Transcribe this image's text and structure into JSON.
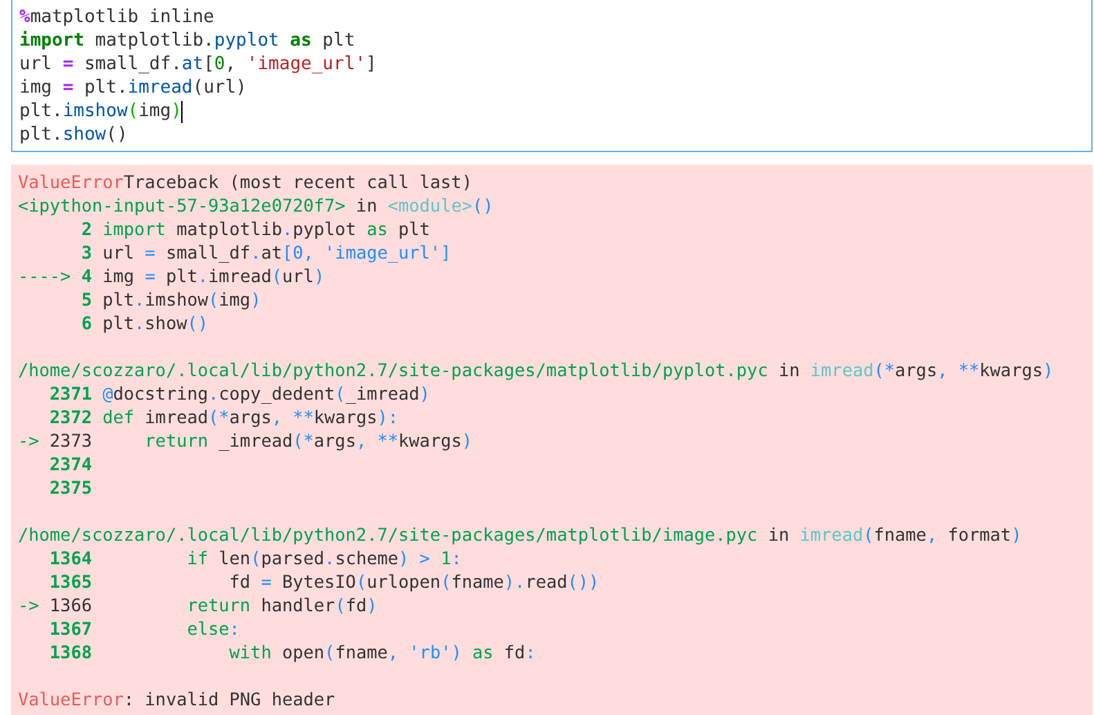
{
  "input_cell": {
    "lines": [
      {
        "cursor": false,
        "segments": [
          {
            "kind": "magic",
            "text": "%"
          },
          {
            "kind": "plain",
            "text": "matplotlib inline"
          }
        ]
      },
      {
        "cursor": false,
        "segments": [
          {
            "kind": "keyword",
            "text": "import"
          },
          {
            "kind": "plain",
            "text": " matplotlib."
          },
          {
            "kind": "attr",
            "text": "pyplot"
          },
          {
            "kind": "keyword",
            "text": " as"
          },
          {
            "kind": "plain",
            "text": " plt"
          }
        ]
      },
      {
        "cursor": false,
        "segments": [
          {
            "kind": "plain",
            "text": "url "
          },
          {
            "kind": "operator",
            "text": "="
          },
          {
            "kind": "plain",
            "text": " small_df."
          },
          {
            "kind": "attr",
            "text": "at"
          },
          {
            "kind": "plain",
            "text": "["
          },
          {
            "kind": "number",
            "text": "0"
          },
          {
            "kind": "plain",
            "text": ", "
          },
          {
            "kind": "string",
            "text": "'image_url'"
          },
          {
            "kind": "plain",
            "text": "]"
          }
        ]
      },
      {
        "cursor": false,
        "segments": [
          {
            "kind": "plain",
            "text": "img "
          },
          {
            "kind": "operator",
            "text": "="
          },
          {
            "kind": "plain",
            "text": " plt."
          },
          {
            "kind": "attr",
            "text": "imread"
          },
          {
            "kind": "plain",
            "text": "(url)"
          }
        ]
      },
      {
        "cursor": true,
        "segments": [
          {
            "kind": "plain",
            "text": "plt."
          },
          {
            "kind": "attr",
            "text": "imshow"
          },
          {
            "kind": "match",
            "text": "("
          },
          {
            "kind": "plain",
            "text": "img"
          },
          {
            "kind": "match",
            "text": ")"
          }
        ]
      },
      {
        "cursor": false,
        "segments": [
          {
            "kind": "plain",
            "text": "plt."
          },
          {
            "kind": "attr",
            "text": "show"
          },
          {
            "kind": "plain",
            "text": "()"
          }
        ]
      }
    ]
  },
  "output": {
    "blocks": [
      [
        {
          "segments": [
            {
              "kind": "error",
              "text": "ValueError"
            },
            {
              "kind": "plain",
              "text": "Traceback (most recent call last)"
            }
          ]
        },
        {
          "segments": [
            {
              "kind": "path",
              "text": "<ipython-input-57-93a12e0720f7>"
            },
            {
              "kind": "plain",
              "text": " in "
            },
            {
              "kind": "func",
              "text": "<module>"
            },
            {
              "kind": "punct",
              "text": "()"
            }
          ]
        },
        {
          "segments": [
            {
              "kind": "lineno",
              "text": "      2 "
            },
            {
              "kind": "keyword",
              "text": "import"
            },
            {
              "kind": "plain",
              "text": " matplotlib"
            },
            {
              "kind": "punct",
              "text": "."
            },
            {
              "kind": "plain",
              "text": "pyplot "
            },
            {
              "kind": "keyword",
              "text": "as"
            },
            {
              "kind": "plain",
              "text": " plt"
            }
          ]
        },
        {
          "segments": [
            {
              "kind": "lineno",
              "text": "      3 "
            },
            {
              "kind": "plain",
              "text": "url "
            },
            {
              "kind": "punct",
              "text": "="
            },
            {
              "kind": "plain",
              "text": " small_df"
            },
            {
              "kind": "punct",
              "text": "."
            },
            {
              "kind": "plain",
              "text": "at"
            },
            {
              "kind": "punct",
              "text": "[0, 'image_url']"
            }
          ]
        },
        {
          "segments": [
            {
              "kind": "path",
              "text": "----> "
            },
            {
              "kind": "lineno",
              "text": "4 "
            },
            {
              "kind": "plain",
              "text": "img "
            },
            {
              "kind": "punct",
              "text": "="
            },
            {
              "kind": "plain",
              "text": " plt"
            },
            {
              "kind": "punct",
              "text": "."
            },
            {
              "kind": "plain",
              "text": "imread"
            },
            {
              "kind": "punct",
              "text": "("
            },
            {
              "kind": "plain",
              "text": "url"
            },
            {
              "kind": "punct",
              "text": ")"
            }
          ]
        },
        {
          "segments": [
            {
              "kind": "lineno",
              "text": "      5 "
            },
            {
              "kind": "plain",
              "text": "plt"
            },
            {
              "kind": "punct",
              "text": "."
            },
            {
              "kind": "plain",
              "text": "imshow"
            },
            {
              "kind": "punct",
              "text": "("
            },
            {
              "kind": "plain",
              "text": "img"
            },
            {
              "kind": "punct",
              "text": ")"
            }
          ]
        },
        {
          "segments": [
            {
              "kind": "lineno",
              "text": "      6 "
            },
            {
              "kind": "plain",
              "text": "plt"
            },
            {
              "kind": "punct",
              "text": "."
            },
            {
              "kind": "plain",
              "text": "show"
            },
            {
              "kind": "punct",
              "text": "()"
            }
          ]
        }
      ],
      [
        {
          "segments": [
            {
              "kind": "path",
              "text": "/home/scozzaro/.local/lib/python2.7/site-packages/matplotlib/pyplot.pyc"
            },
            {
              "kind": "plain",
              "text": " in "
            },
            {
              "kind": "func",
              "text": "imread"
            },
            {
              "kind": "punct",
              "text": "(*"
            },
            {
              "kind": "plain",
              "text": "args"
            },
            {
              "kind": "punct",
              "text": ", **"
            },
            {
              "kind": "plain",
              "text": "kwargs"
            },
            {
              "kind": "punct",
              "text": ")"
            }
          ]
        },
        {
          "segments": [
            {
              "kind": "lineno",
              "text": "   2371 "
            },
            {
              "kind": "punct",
              "text": "@"
            },
            {
              "kind": "plain",
              "text": "docstring"
            },
            {
              "kind": "punct",
              "text": "."
            },
            {
              "kind": "plain",
              "text": "copy_dedent"
            },
            {
              "kind": "punct",
              "text": "("
            },
            {
              "kind": "plain",
              "text": "_imread"
            },
            {
              "kind": "punct",
              "text": ")"
            }
          ]
        },
        {
          "segments": [
            {
              "kind": "lineno",
              "text": "   2372 "
            },
            {
              "kind": "keyword",
              "text": "def"
            },
            {
              "kind": "plain",
              "text": " imread"
            },
            {
              "kind": "punct",
              "text": "(*"
            },
            {
              "kind": "plain",
              "text": "args"
            },
            {
              "kind": "punct",
              "text": ", **"
            },
            {
              "kind": "plain",
              "text": "kwargs"
            },
            {
              "kind": "punct",
              "text": "):"
            }
          ]
        },
        {
          "segments": [
            {
              "kind": "path",
              "text": "-> "
            },
            {
              "kind": "plain",
              "text": "2373     "
            },
            {
              "kind": "keyword",
              "text": "return"
            },
            {
              "kind": "plain",
              "text": " _imread"
            },
            {
              "kind": "punct",
              "text": "(*"
            },
            {
              "kind": "plain",
              "text": "args"
            },
            {
              "kind": "punct",
              "text": ", **"
            },
            {
              "kind": "plain",
              "text": "kwargs"
            },
            {
              "kind": "punct",
              "text": ")"
            }
          ]
        },
        {
          "segments": [
            {
              "kind": "lineno",
              "text": "   2374"
            }
          ]
        },
        {
          "segments": [
            {
              "kind": "lineno",
              "text": "   2375"
            }
          ]
        }
      ],
      [
        {
          "segments": [
            {
              "kind": "path",
              "text": "/home/scozzaro/.local/lib/python2.7/site-packages/matplotlib/image.pyc"
            },
            {
              "kind": "plain",
              "text": " in "
            },
            {
              "kind": "func",
              "text": "imread"
            },
            {
              "kind": "punct",
              "text": "("
            },
            {
              "kind": "plain",
              "text": "fname"
            },
            {
              "kind": "punct",
              "text": ", "
            },
            {
              "kind": "plain",
              "text": "format"
            },
            {
              "kind": "punct",
              "text": ")"
            }
          ]
        },
        {
          "segments": [
            {
              "kind": "lineno",
              "text": "   1364         "
            },
            {
              "kind": "keyword",
              "text": "if"
            },
            {
              "kind": "plain",
              "text": " len"
            },
            {
              "kind": "punct",
              "text": "("
            },
            {
              "kind": "plain",
              "text": "parsed"
            },
            {
              "kind": "punct",
              "text": "."
            },
            {
              "kind": "plain",
              "text": "scheme"
            },
            {
              "kind": "punct",
              "text": ") > "
            },
            {
              "kind": "keyword",
              "text": "1"
            },
            {
              "kind": "punct",
              "text": ":"
            }
          ]
        },
        {
          "segments": [
            {
              "kind": "lineno",
              "text": "   1365 "
            },
            {
              "kind": "plain",
              "text": "            fd "
            },
            {
              "kind": "punct",
              "text": "="
            },
            {
              "kind": "plain",
              "text": " BytesIO"
            },
            {
              "kind": "punct",
              "text": "("
            },
            {
              "kind": "plain",
              "text": "urlopen"
            },
            {
              "kind": "punct",
              "text": "("
            },
            {
              "kind": "plain",
              "text": "fname"
            },
            {
              "kind": "punct",
              "text": ")."
            },
            {
              "kind": "plain",
              "text": "read"
            },
            {
              "kind": "punct",
              "text": "())"
            }
          ]
        },
        {
          "segments": [
            {
              "kind": "path",
              "text": "-> "
            },
            {
              "kind": "plain",
              "text": "1366         "
            },
            {
              "kind": "keyword",
              "text": "return"
            },
            {
              "kind": "plain",
              "text": " handler"
            },
            {
              "kind": "punct",
              "text": "("
            },
            {
              "kind": "plain",
              "text": "fd"
            },
            {
              "kind": "punct",
              "text": ")"
            }
          ]
        },
        {
          "segments": [
            {
              "kind": "lineno",
              "text": "   1367         "
            },
            {
              "kind": "keyword",
              "text": "else"
            },
            {
              "kind": "punct",
              "text": ":"
            }
          ]
        },
        {
          "segments": [
            {
              "kind": "lineno",
              "text": "   1368             "
            },
            {
              "kind": "keyword",
              "text": "with"
            },
            {
              "kind": "plain",
              "text": " open"
            },
            {
              "kind": "punct",
              "text": "("
            },
            {
              "kind": "plain",
              "text": "fname"
            },
            {
              "kind": "punct",
              "text": ", 'rb') "
            },
            {
              "kind": "keyword",
              "text": "as"
            },
            {
              "kind": "plain",
              "text": " fd"
            },
            {
              "kind": "punct",
              "text": ":"
            }
          ]
        }
      ],
      [
        {
          "segments": [
            {
              "kind": "error",
              "text": "ValueError"
            },
            {
              "kind": "plain",
              "text": ": invalid PNG header"
            }
          ]
        }
      ]
    ]
  }
}
